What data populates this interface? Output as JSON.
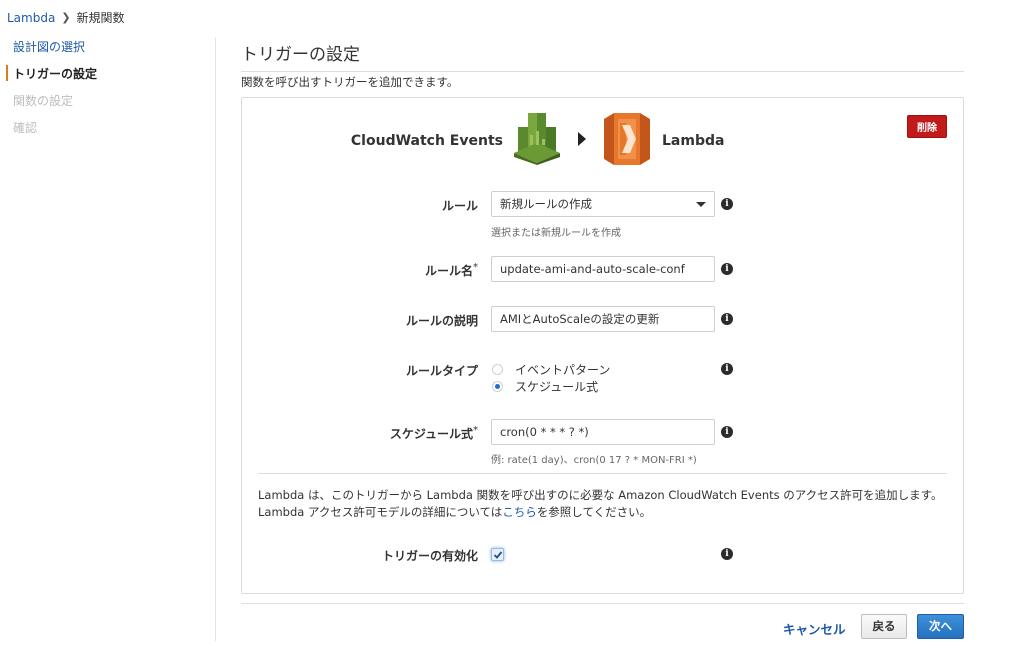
{
  "breadcrumb": {
    "root": "Lambda",
    "current": "新規関数"
  },
  "steps": [
    {
      "label": "設計図の選択",
      "state": "link"
    },
    {
      "label": "トリガーの設定",
      "state": "active"
    },
    {
      "label": "関数の設定",
      "state": "disabled"
    },
    {
      "label": "確認",
      "state": "disabled"
    }
  ],
  "page": {
    "title": "トリガーの設定",
    "subtitle": "関数を呼び出すトリガーを追加できます。"
  },
  "trigger": {
    "source": "CloudWatch Events",
    "destination": "Lambda",
    "delete_label": "削除",
    "source_icon": "cloudwatch-icon",
    "destination_icon": "lambda-icon"
  },
  "form": {
    "rule": {
      "label": "ルール",
      "value": "新規ルールの作成",
      "help": "選択または新規ルールを作成"
    },
    "rule_name": {
      "label": "ルール名",
      "required_mark": "*",
      "value": "update-ami-and-auto-scale-conf"
    },
    "rule_description": {
      "label": "ルールの説明",
      "value": "AMIとAutoScaleの設定の更新"
    },
    "rule_type": {
      "label": "ルールタイプ",
      "options": [
        {
          "label": "イベントパターン",
          "selected": false
        },
        {
          "label": "スケジュール式",
          "selected": true
        }
      ]
    },
    "schedule": {
      "label": "スケジュール式",
      "required_mark": "*",
      "value": "cron(0 * * * ? *)",
      "help": "例: rate(1 day)、cron(0 17 ? * MON-FRI *)"
    }
  },
  "permission": {
    "text_before": "Lambda は、このトリガーから Lambda 関数を呼び出すのに必要な Amazon CloudWatch Events のアクセス許可を追加します。Lambda アクセス許可モデルの詳細については",
    "link": "こちら",
    "text_after": "を参照してください。"
  },
  "enable": {
    "label": "トリガーの有効化",
    "checked": true
  },
  "footer": {
    "cancel": "キャンセル",
    "back": "戻る",
    "next": "次へ"
  },
  "colors": {
    "accent": "#e07a1a",
    "link": "#1f5aa8",
    "delete": "#c21a1a",
    "primary": "#2472c0"
  }
}
